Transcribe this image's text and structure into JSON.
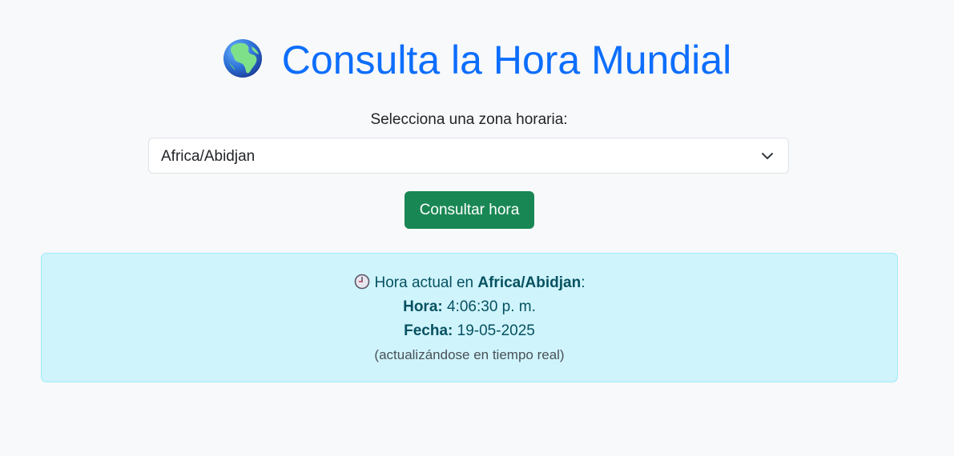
{
  "header": {
    "title": "Consulta la Hora Mundial",
    "globe_icon": "globe-africa-icon"
  },
  "timezone_select": {
    "label": "Selecciona una zona horaria:",
    "value": "Africa/Abidjan",
    "chevron_icon": "chevron-down-icon"
  },
  "query_button": {
    "label": "Consultar hora"
  },
  "result": {
    "clock_icon": "clock-icon",
    "prefix": "Hora actual en ",
    "zone": "Africa/Abidjan",
    "suffix": ":",
    "time_label": "Hora:",
    "time_value": "4:06:30 p. m.",
    "date_label": "Fecha:",
    "date_value": "19-05-2025",
    "note": "(actualizándose en tiempo real)"
  },
  "colors": {
    "background": "#f8f9fa",
    "title": "#0d6efd",
    "button": "#198754",
    "alert_bg": "#cff4fc",
    "alert_border": "#9eeaf9",
    "alert_text": "#055160"
  }
}
